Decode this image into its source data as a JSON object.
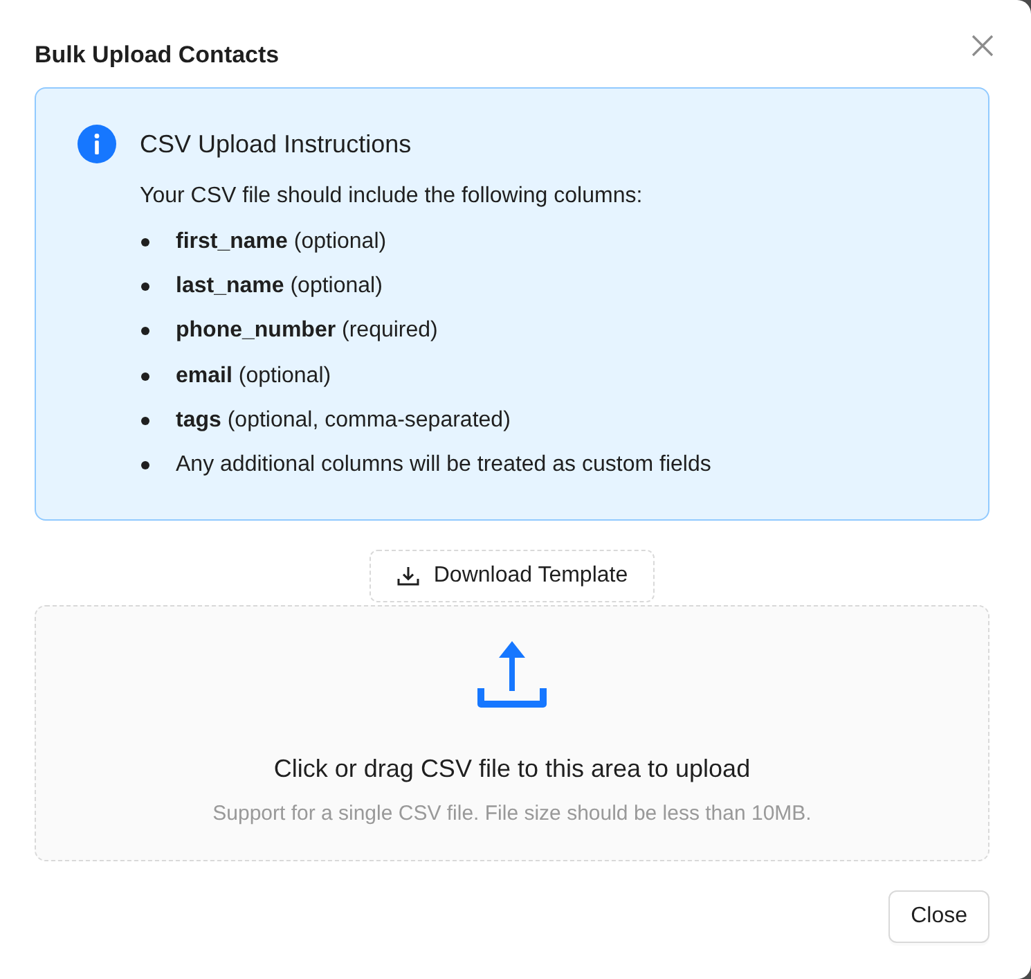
{
  "dialog": {
    "title": "Bulk Upload Contacts"
  },
  "instructions": {
    "title": "CSV Upload Instructions",
    "intro": "Your CSV file should include the following columns:",
    "items": [
      "**first_name** (optional)",
      "**last_name** (optional)",
      "**phone_number** (required)",
      "**email** (optional)",
      "**tags** (optional, comma-separated)",
      "Any additional columns will be treated as custom fields"
    ]
  },
  "download_button": {
    "label": "Download Template"
  },
  "dropzone": {
    "text": "Click or drag CSV file to this area to upload",
    "hint": "Support for a single CSV file. File size should be less than 10MB."
  },
  "footer": {
    "buttons": [
      "Close"
    ]
  }
}
